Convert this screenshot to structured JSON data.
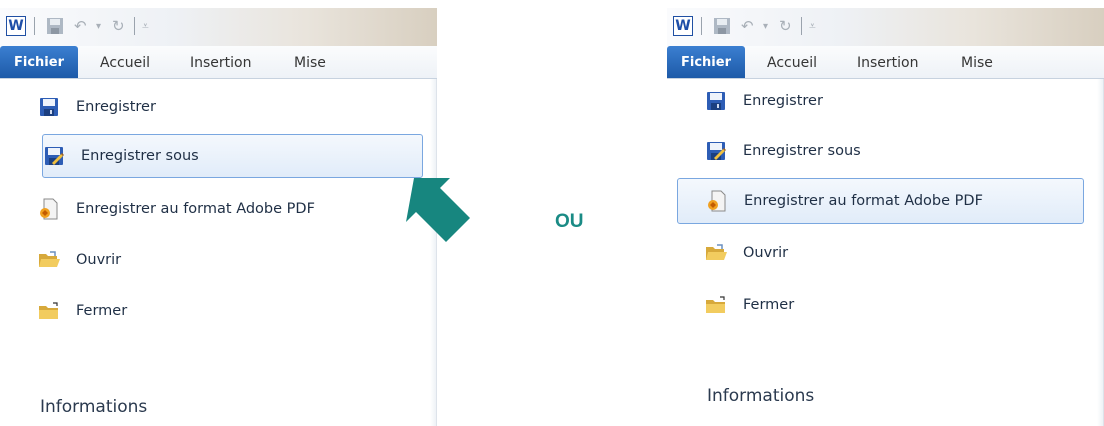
{
  "tabs": {
    "file": "Fichier",
    "home": "Accueil",
    "insert": "Insertion",
    "layout": "Mise"
  },
  "menu": {
    "items": [
      {
        "label": "Enregistrer",
        "icon": "save-icon"
      },
      {
        "label": "Enregistrer sous",
        "icon": "save-as-icon"
      },
      {
        "label": "Enregistrer au format Adobe PDF",
        "icon": "pdf-icon"
      },
      {
        "label": "Ouvrir",
        "icon": "open-folder-icon"
      },
      {
        "label": "Fermer",
        "icon": "close-folder-icon"
      }
    ],
    "info": "Informations"
  },
  "separator_text": "OU",
  "colors": {
    "file_tab": "#1d5aa8",
    "accent_teal": "#1a8b85",
    "highlight_border": "#7aa7e0"
  }
}
